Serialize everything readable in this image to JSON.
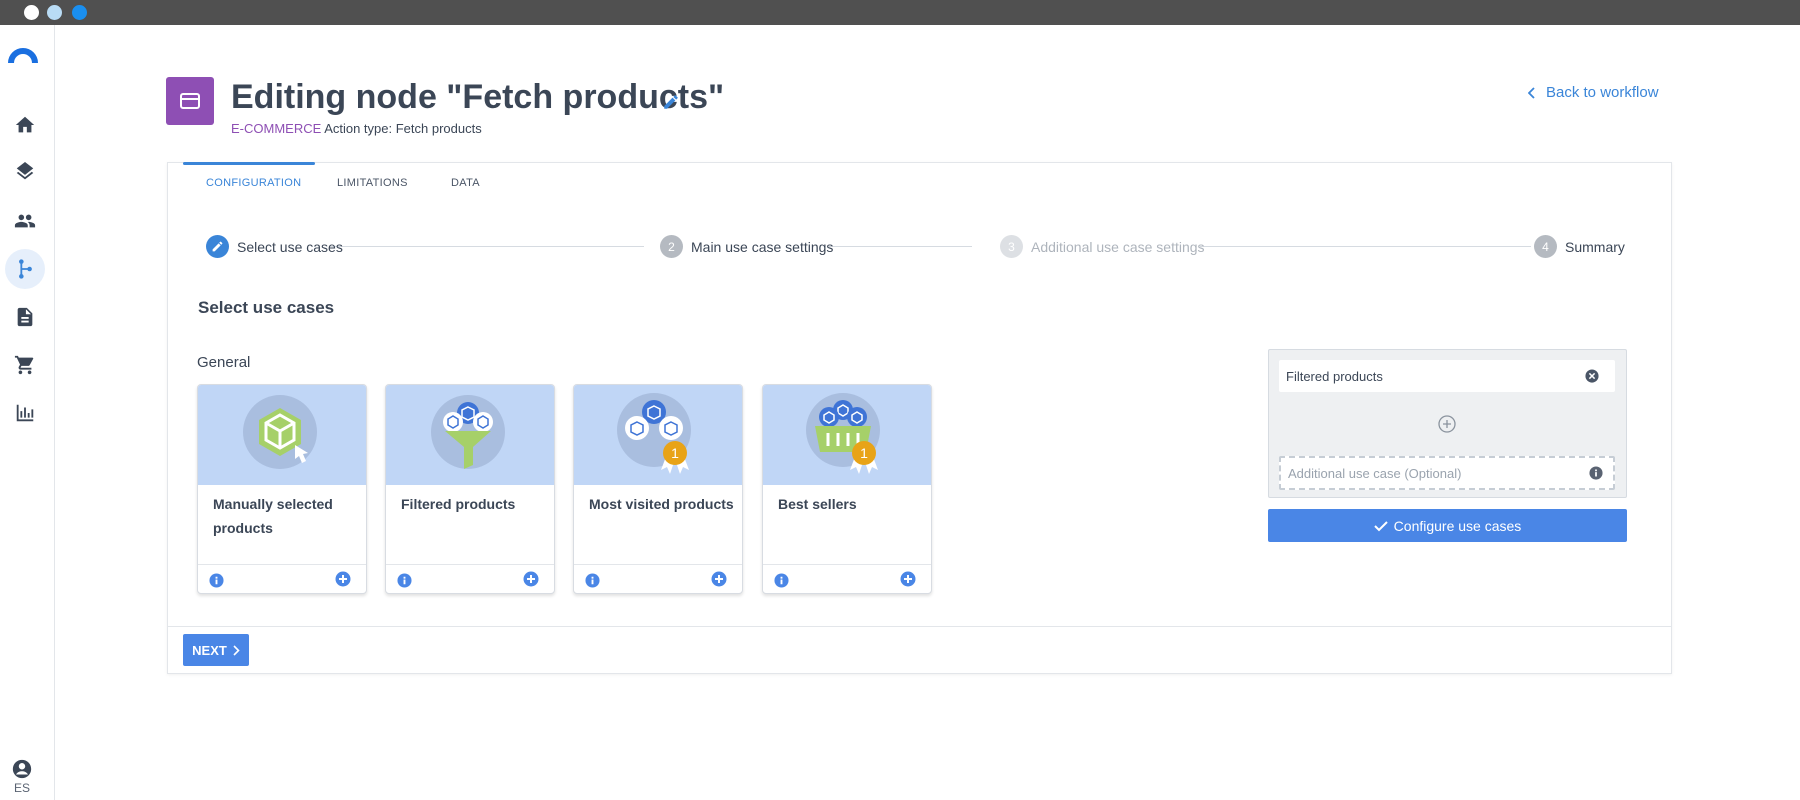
{
  "window": {
    "controls": [
      "close",
      "minimize",
      "maximize"
    ]
  },
  "sidebar": {
    "logo": "brand-logo",
    "items": [
      {
        "icon": "home-icon"
      },
      {
        "icon": "layers-icon"
      },
      {
        "icon": "people-icon"
      },
      {
        "icon": "workflow-icon",
        "active": true
      },
      {
        "icon": "document-icon"
      },
      {
        "icon": "cart-icon"
      },
      {
        "icon": "bar-chart-icon"
      }
    ],
    "user_icon": "account-icon",
    "language": "ES"
  },
  "header": {
    "title": "Editing node \"Fetch products\"",
    "category": "E-COMMERCE",
    "action_type": "Action type: Fetch products",
    "back_link": "Back to workflow",
    "icon_color": "#8e4fb4"
  },
  "tabs": [
    {
      "label": "CONFIGURATION",
      "active": true
    },
    {
      "label": "LIMITATIONS",
      "active": false
    },
    {
      "label": "DATA",
      "active": false
    }
  ],
  "stepper": [
    {
      "number": "",
      "label": "Select use cases",
      "state": "current"
    },
    {
      "number": "2",
      "label": "Main use case settings",
      "state": "pending"
    },
    {
      "number": "3",
      "label": "Additional use case settings",
      "state": "disabled"
    },
    {
      "number": "4",
      "label": "Summary",
      "state": "pending"
    }
  ],
  "section_title": "Select use cases",
  "group_label": "General",
  "use_cases": [
    {
      "title": "Manually selected products",
      "icon": "manual-select-icon"
    },
    {
      "title": "Filtered products",
      "icon": "filter-icon"
    },
    {
      "title": "Most visited products",
      "icon": "most-visited-icon",
      "badge": "1"
    },
    {
      "title": "Best sellers",
      "icon": "best-sellers-icon",
      "badge": "1"
    }
  ],
  "selection": {
    "selected": "Filtered products",
    "additional_placeholder": "Additional use case (Optional)",
    "configure_button": "Configure use cases"
  },
  "next_button": "NEXT",
  "colors": {
    "accent": "#4a86e6",
    "link": "#3a85d8",
    "category": "#8e4fb4",
    "card_image_bg": "#c0d6f6"
  }
}
